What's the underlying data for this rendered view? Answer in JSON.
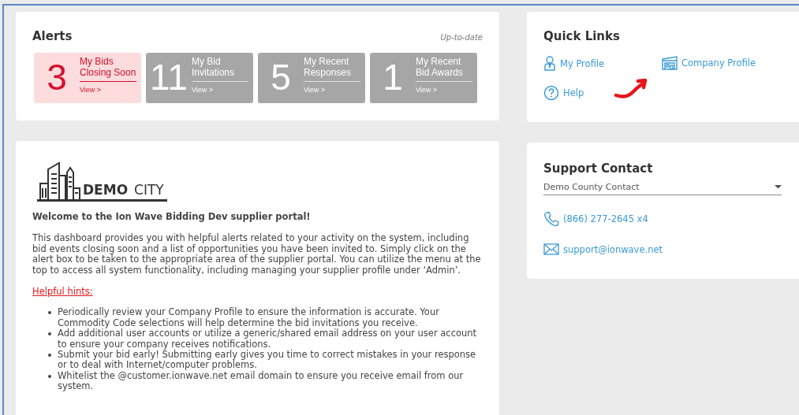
{
  "alerts": {
    "title": "Alerts",
    "status": "Up-to-date",
    "tiles": [
      {
        "count": "3",
        "label": "My Bids Closing Soon",
        "link": "View >",
        "kind": "urgent"
      },
      {
        "count": "11",
        "label": "My Bid Invitations",
        "link": "View >",
        "kind": "plain"
      },
      {
        "count": "5",
        "label": "My Recent Responses",
        "link": "View >",
        "kind": "plain"
      },
      {
        "count": "1",
        "label": "My Recent Bid Awards",
        "link": "View >",
        "kind": "plain"
      }
    ]
  },
  "welcome": {
    "logo": {
      "bold": "DEMO",
      "light": "CITY"
    },
    "heading": "Welcome to the Ion Wave Bidding Dev supplier portal!",
    "intro": "This dashboard provides you with helpful alerts related to your activity on the system, including bid events closing soon and a list of opportunities you have been invited to. Simply click on the alert box to be taken to the appropriate area of the supplier portal. You can utilize the menu at the top to access all system functionality, including managing your supplier profile under ‘Admin’.",
    "hints_title": "Helpful hints:",
    "hints": [
      "Periodically review your Company Profile to ensure the information is accurate. Your Commodity Code selections will help determine the bid invitations you receive.",
      "Add additional user accounts or utilize a generic/shared email address on your user account to ensure your company receives notifications.",
      "Submit your bid early! Submitting early gives you time to correct mistakes in your response or to deal with Internet/computer problems.",
      "Whitelist the @customer.ionwave.net email domain to ensure you receive email from our system."
    ]
  },
  "quick_links": {
    "title": "Quick Links",
    "links": [
      {
        "label": "My Profile",
        "kind": "person"
      },
      {
        "label": "Company Profile",
        "kind": "building"
      },
      {
        "label": "Help",
        "kind": "help"
      }
    ]
  },
  "support": {
    "title": "Support Contact",
    "contact_select": "Demo County Contact",
    "items": [
      {
        "label": "(866) 277-2645 x4",
        "kind": "phone"
      },
      {
        "label": "support@ionwave.net",
        "kind": "email"
      }
    ]
  }
}
